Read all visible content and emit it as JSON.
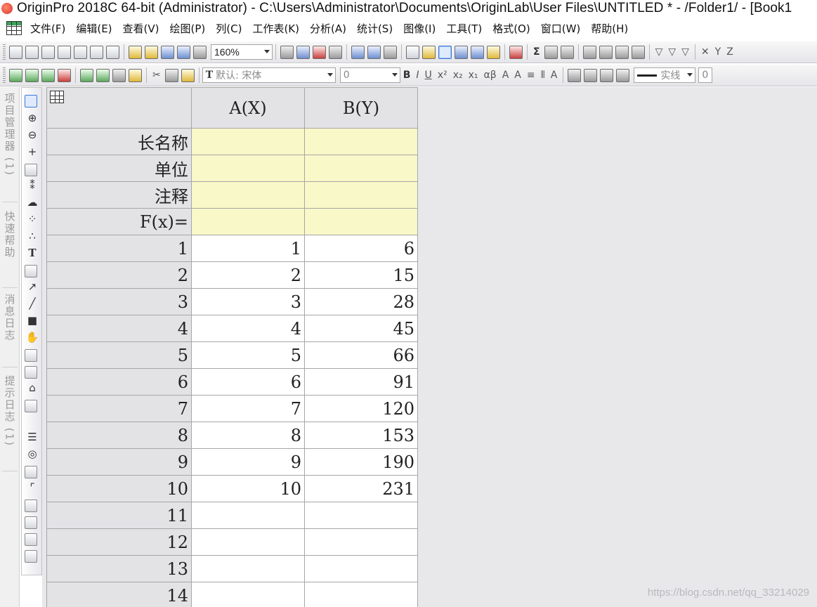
{
  "window": {
    "title": "OriginPro 2018C 64-bit (Administrator) - C:\\Users\\Administrator\\Documents\\OriginLab\\User Files\\UNTITLED * - /Folder1/ - [Book1"
  },
  "menu": {
    "items": [
      "文件(F)",
      "编辑(E)",
      "查看(V)",
      "绘图(P)",
      "列(C)",
      "工作表(K)",
      "分析(A)",
      "统计(S)",
      "图像(I)",
      "工具(T)",
      "格式(O)",
      "窗口(W)",
      "帮助(H)"
    ]
  },
  "toolbar": {
    "zoom": "160%",
    "font_name": "默认: 宋体",
    "font_size": "0",
    "line_style": "实线",
    "line_width": "0"
  },
  "side_tabs": [
    "项目管理器 (1)",
    "快速帮助",
    "消息日志",
    "提示日志 (1)"
  ],
  "sheet": {
    "columns": [
      "A(X)",
      "B(Y)"
    ],
    "meta_rows": [
      "长名称",
      "单位",
      "注释",
      "F(x)="
    ],
    "rows": [
      {
        "n": "1",
        "a": "1",
        "b": "6"
      },
      {
        "n": "2",
        "a": "2",
        "b": "15"
      },
      {
        "n": "3",
        "a": "3",
        "b": "28"
      },
      {
        "n": "4",
        "a": "4",
        "b": "45"
      },
      {
        "n": "5",
        "a": "5",
        "b": "66"
      },
      {
        "n": "6",
        "a": "6",
        "b": "91"
      },
      {
        "n": "7",
        "a": "7",
        "b": "120"
      },
      {
        "n": "8",
        "a": "8",
        "b": "153"
      },
      {
        "n": "9",
        "a": "9",
        "b": "190"
      },
      {
        "n": "10",
        "a": "10",
        "b": "231"
      },
      {
        "n": "11",
        "a": "",
        "b": ""
      },
      {
        "n": "12",
        "a": "",
        "b": ""
      },
      {
        "n": "13",
        "a": "",
        "b": ""
      },
      {
        "n": "14",
        "a": "",
        "b": ""
      }
    ]
  },
  "watermark": "https://blog.csdn.net/qq_33214029"
}
